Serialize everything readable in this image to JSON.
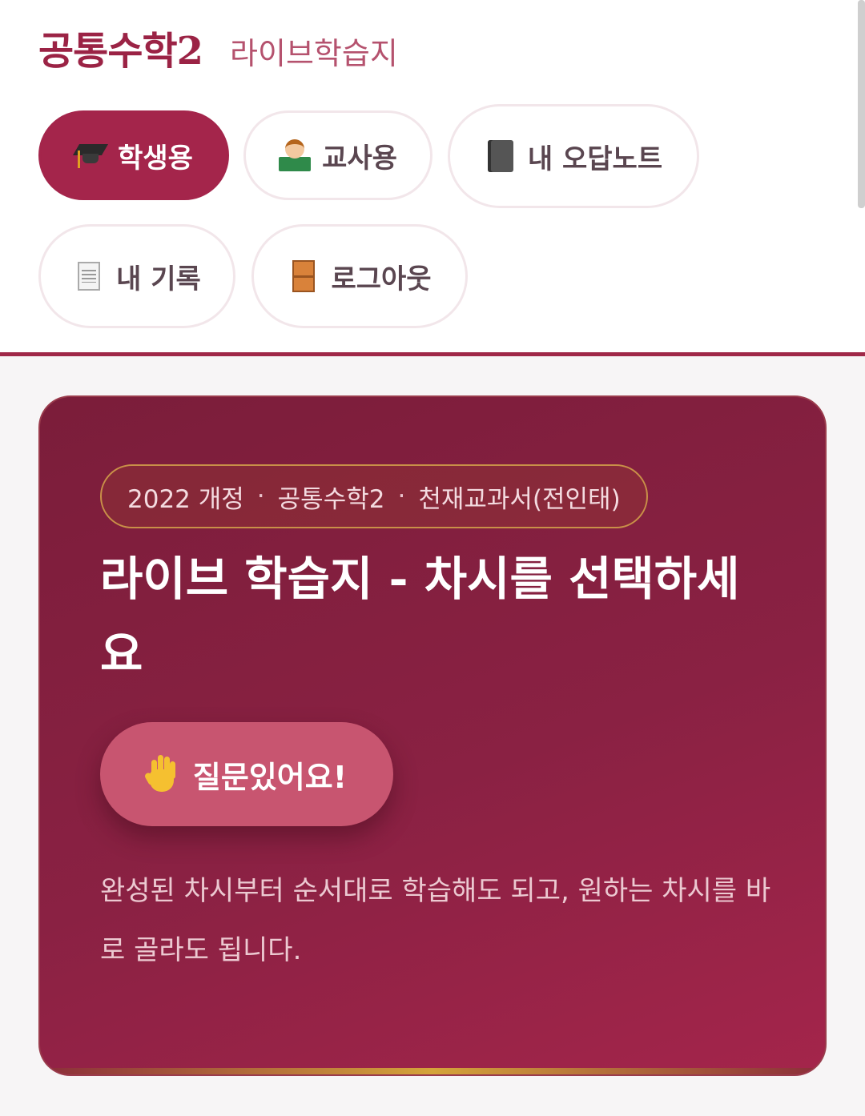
{
  "header": {
    "title": "공통수학2",
    "subtitle": "라이브학습지"
  },
  "nav": {
    "items": [
      {
        "label": "학생용",
        "icon": "graduation-cap-icon",
        "active": true
      },
      {
        "label": "교사용",
        "icon": "teacher-icon",
        "active": false
      },
      {
        "label": "내 오답노트",
        "icon": "notebook-icon",
        "active": false
      },
      {
        "label": "내 기록",
        "icon": "document-icon",
        "active": false
      },
      {
        "label": "로그아웃",
        "icon": "door-icon",
        "active": false
      }
    ]
  },
  "hero": {
    "meta": [
      "2022 개정",
      "공통수학2",
      "천재교과서(전인태)"
    ],
    "meta_separator": "·",
    "title": "라이브 학습지 - 차시를 선택하세요",
    "ask_button_label": "질문있어요!",
    "ask_button_icon": "raised-hand-icon",
    "description": "완성된 차시부터 순서대로 학습해도 되고, 원하는 차시를 바로 골라도 됩니다."
  },
  "colors": {
    "brand": "#9b2345",
    "active_pill": "#a4254b",
    "card_bg": "#8a2143",
    "ask_button": "#c85570",
    "accent_gold": "#d4a43a"
  }
}
